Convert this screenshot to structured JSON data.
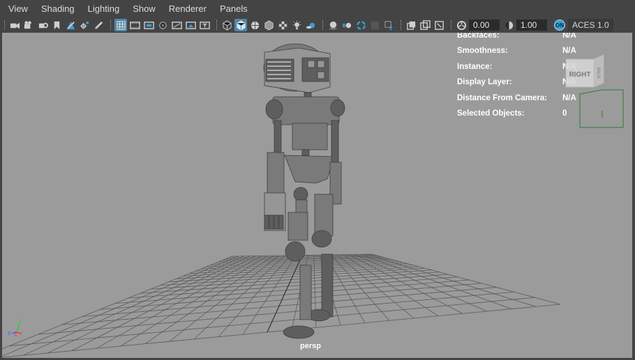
{
  "menu": [
    "View",
    "Shading",
    "Lighting",
    "Show",
    "Renderer",
    "Panels"
  ],
  "toolbar": {
    "icons": [
      "select-camera-icon",
      "camera-attributes-icon",
      "bookmark-icon",
      "image-plane-icon",
      "2d-pan-zoom-icon",
      "grease-pencil-icon",
      "grid-icon",
      "film-gate-icon",
      "resolution-gate-icon",
      "gate-mask-icon",
      "field-chart-icon",
      "safe-action-icon",
      "safe-title-icon",
      "wireframe-icon",
      "smooth-shade-icon",
      "wireframe-on-shaded-icon",
      "use-default-material-icon",
      "textured-icon",
      "use-all-lights-icon",
      "shadows-icon",
      "screen-space-ambient-occlusion-icon",
      "motion-blur-icon",
      "anti-aliasing-icon",
      "isolate-select-icon",
      "xray-icon",
      "xray-joints-icon",
      "backface-culling-icon",
      "exposure-icon",
      "gamma-icon",
      "color-management-icon"
    ],
    "exposure_value": "0.00",
    "gamma_value": "1.00",
    "color_mgmt_toggle": "ON",
    "view_transform": "ACES 1.0"
  },
  "hud": [
    {
      "label": "Backfaces:",
      "value": "N/A"
    },
    {
      "label": "Smoothness:",
      "value": "N/A"
    },
    {
      "label": "Instance:",
      "value": "N/A"
    },
    {
      "label": "Display Layer:",
      "value": "N/A"
    },
    {
      "label": "Distance From Camera:",
      "value": "N/A"
    },
    {
      "label": "Selected Objects:",
      "value": "0"
    }
  ],
  "viewcube": {
    "front": "RIGHT",
    "side": "BACK"
  },
  "camera_name": "persp",
  "axis": {
    "x": "X",
    "y": "Y",
    "z": "Z"
  },
  "colors": {
    "viewport_bg": "#9b9b9b",
    "grid_line": "#5a5a5a",
    "active_button": "#5285a6",
    "axis_x": "#ff3030",
    "axis_y": "#30d030",
    "axis_z": "#3060ff"
  }
}
